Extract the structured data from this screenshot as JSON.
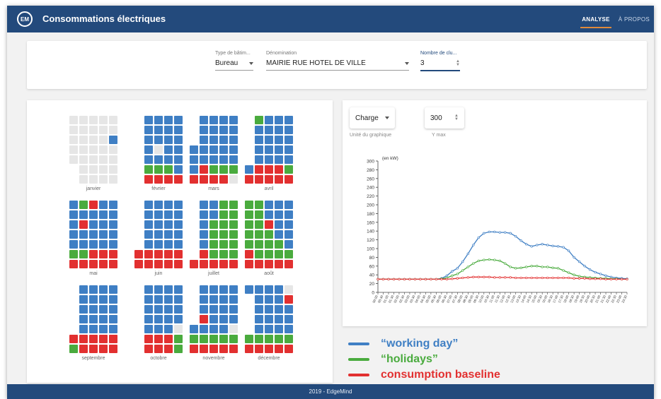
{
  "header": {
    "logo_text": "EM",
    "title": "Consommations électriques",
    "tabs": [
      {
        "label": "ANALYSE",
        "active": true
      },
      {
        "label": "À PROPOS",
        "active": false
      }
    ]
  },
  "filters": {
    "building_type": {
      "label": "Type de bâtim...",
      "value": "Bureau"
    },
    "name": {
      "label": "Dénomination",
      "value": "MAIRIE RUE HOTEL DE VILLE"
    },
    "clusters": {
      "label": "Nombre de clu...",
      "value": "3"
    }
  },
  "calendar": {
    "colors": {
      "g": "#e6e6e6",
      "b": "#3f7fc4",
      "n": "#4aab3e",
      "r": "#e23030"
    },
    "months": [
      {
        "label": "janvier",
        "rows": [
          "ggggg",
          "ggggg",
          "ggggb",
          "ggggg",
          "ggggg",
          "gggg",
          "gggg"
        ]
      },
      {
        "label": "février",
        "rows": [
          "bbbb",
          "bbbb",
          "bbbb",
          "bgbb",
          "bbbb",
          "nnnb",
          "rrrr"
        ]
      },
      {
        "label": "mars",
        "rows": [
          "bbbb",
          "bbbb",
          "bbbb",
          "bbbbb",
          "bbbbb",
          "brnnn",
          "rrrrg"
        ]
      },
      {
        "label": "avril",
        "rows": [
          "nbbb",
          "bbbb",
          "bbbb",
          "bbbb",
          "bbbb",
          "brrrn",
          "rrrrr"
        ]
      },
      {
        "label": "mai",
        "rows": [
          "bnrbb",
          "bbbbb",
          "brbbb",
          "bbbbb",
          "bbbbb",
          "nnrrr",
          "rrrrr"
        ]
      },
      {
        "label": "juin",
        "rows": [
          "bbbb",
          "bbbb",
          "bbbb",
          "bbbb",
          "bbbb",
          "rrrrr",
          "rrrrr"
        ]
      },
      {
        "label": "juillet",
        "rows": [
          "bbnn",
          "bbnn",
          "bnnn",
          "bnnn",
          "bnnn",
          "rnnn",
          "rrrrr"
        ]
      },
      {
        "label": "août",
        "rows": [
          "nnbbb",
          "nnbbb",
          "nnrbb",
          "nnnbb",
          "nnnnb",
          "rnnnn",
          "rrrrr"
        ]
      },
      {
        "label": "septembre",
        "rows": [
          "bbbb",
          "bbbb",
          "bbbb",
          "bbbb",
          "bbbb",
          "rrrrr",
          "nrrrr"
        ]
      },
      {
        "label": "octobre",
        "rows": [
          "bbbb",
          "bbbb",
          "bbbb",
          "bbbb",
          "bbbg",
          "rrrn",
          "rrrn"
        ]
      },
      {
        "label": "novembre",
        "rows": [
          "bbbb",
          "bbbb",
          "bbbb",
          "rbbb",
          "bbbbg",
          "nnnnn",
          "rrrrr"
        ]
      },
      {
        "label": "décembre",
        "rows": [
          "bbbbg",
          "bbbr",
          "bbbb",
          "bbbb",
          "bbbb",
          "nnnnn",
          "rrrrr"
        ]
      }
    ]
  },
  "controls": {
    "unit_select": "Charge",
    "unit_label": "Unité du graphique",
    "ymax_value": "300",
    "ymax_label": "Y max"
  },
  "chart_data": {
    "type": "line",
    "ylabel": "(en kW)",
    "ylim": [
      0,
      300
    ],
    "yticks": [
      0,
      20,
      40,
      60,
      80,
      100,
      120,
      140,
      160,
      180,
      200,
      220,
      240,
      260,
      280,
      300
    ],
    "x": [
      "00:00",
      "00:30",
      "01:00",
      "01:30",
      "02:00",
      "02:30",
      "03:00",
      "03:30",
      "04:00",
      "04:30",
      "05:00",
      "05:30",
      "06:00",
      "06:30",
      "07:00",
      "07:30",
      "08:00",
      "08:30",
      "09:00",
      "09:30",
      "10:00",
      "10:30",
      "11:00",
      "11:30",
      "12:00",
      "12:30",
      "13:00",
      "13:30",
      "14:00",
      "14:30",
      "15:00",
      "15:30",
      "16:00",
      "16:30",
      "17:00",
      "17:30",
      "18:00",
      "18:30",
      "19:00",
      "19:30",
      "20:00",
      "20:30",
      "21:00",
      "21:30",
      "22:00",
      "22:30",
      "23:00",
      "23:30"
    ],
    "series": [
      {
        "name": "working day",
        "color": "#3f7fc4",
        "values": [
          30,
          30,
          30,
          30,
          30,
          30,
          30,
          30,
          30,
          30,
          30,
          30,
          32,
          38,
          48,
          55,
          70,
          88,
          108,
          125,
          135,
          138,
          138,
          137,
          137,
          135,
          128,
          118,
          110,
          105,
          108,
          110,
          108,
          106,
          105,
          103,
          95,
          80,
          70,
          60,
          52,
          46,
          42,
          38,
          35,
          33,
          32,
          31
        ]
      },
      {
        "name": "holidays",
        "color": "#4aab3e",
        "values": [
          30,
          30,
          30,
          30,
          30,
          30,
          30,
          30,
          30,
          30,
          30,
          30,
          31,
          33,
          38,
          42,
          50,
          58,
          66,
          72,
          74,
          75,
          74,
          72,
          66,
          58,
          55,
          56,
          58,
          60,
          60,
          58,
          58,
          56,
          55,
          50,
          45,
          40,
          37,
          35,
          34,
          33,
          32,
          32,
          31,
          31,
          30,
          30
        ]
      },
      {
        "name": "consumption baseline",
        "color": "#e23030",
        "values": [
          30,
          30,
          30,
          30,
          30,
          30,
          30,
          30,
          30,
          30,
          30,
          30,
          30,
          30,
          31,
          32,
          33,
          34,
          35,
          35,
          35,
          35,
          34,
          34,
          34,
          34,
          33,
          33,
          33,
          33,
          33,
          33,
          33,
          33,
          33,
          33,
          33,
          32,
          32,
          32,
          31,
          31,
          31,
          30,
          30,
          30,
          30,
          30
        ]
      }
    ]
  },
  "legend": [
    {
      "label": "“working day”",
      "color": "#3f7fc4"
    },
    {
      "label": "“holidays”",
      "color": "#4aab3e"
    },
    {
      "label": "consumption baseline",
      "color": "#e23030"
    }
  ],
  "footer": {
    "text": "2019 - EdgeMind"
  }
}
